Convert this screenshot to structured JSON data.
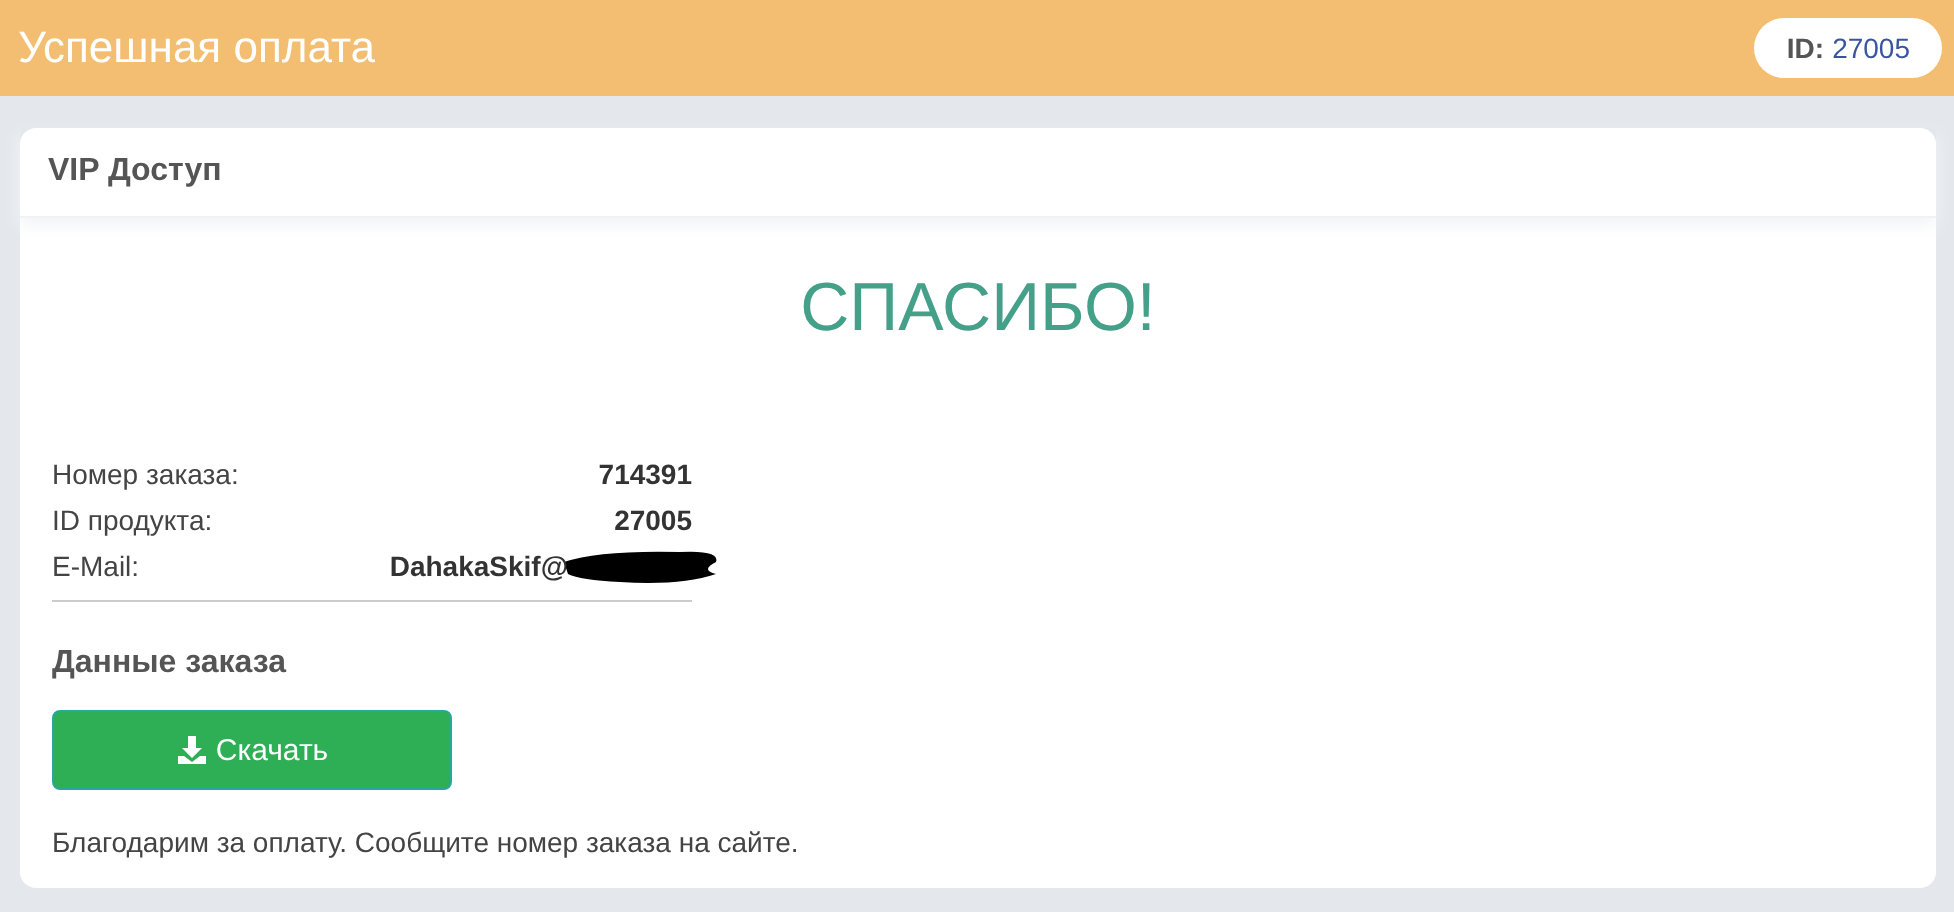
{
  "header": {
    "title": "Успешная оплата",
    "badge_label": "ID:",
    "badge_value": "27005"
  },
  "card": {
    "title": "VIP Доступ",
    "thanks": "СПАСИБО!",
    "details": [
      {
        "label": "Номер заказа:",
        "value": "714391",
        "redacted": false
      },
      {
        "label": "ID продукта:",
        "value": "27005",
        "redacted": false
      },
      {
        "label": "E-Mail:",
        "value": "DahakaSkif@",
        "redacted": true
      }
    ],
    "section_title": "Данные заказа",
    "download_button": "Скачать",
    "note": "Благодарим за оплату. Сообщите номер заказа на сайте."
  }
}
